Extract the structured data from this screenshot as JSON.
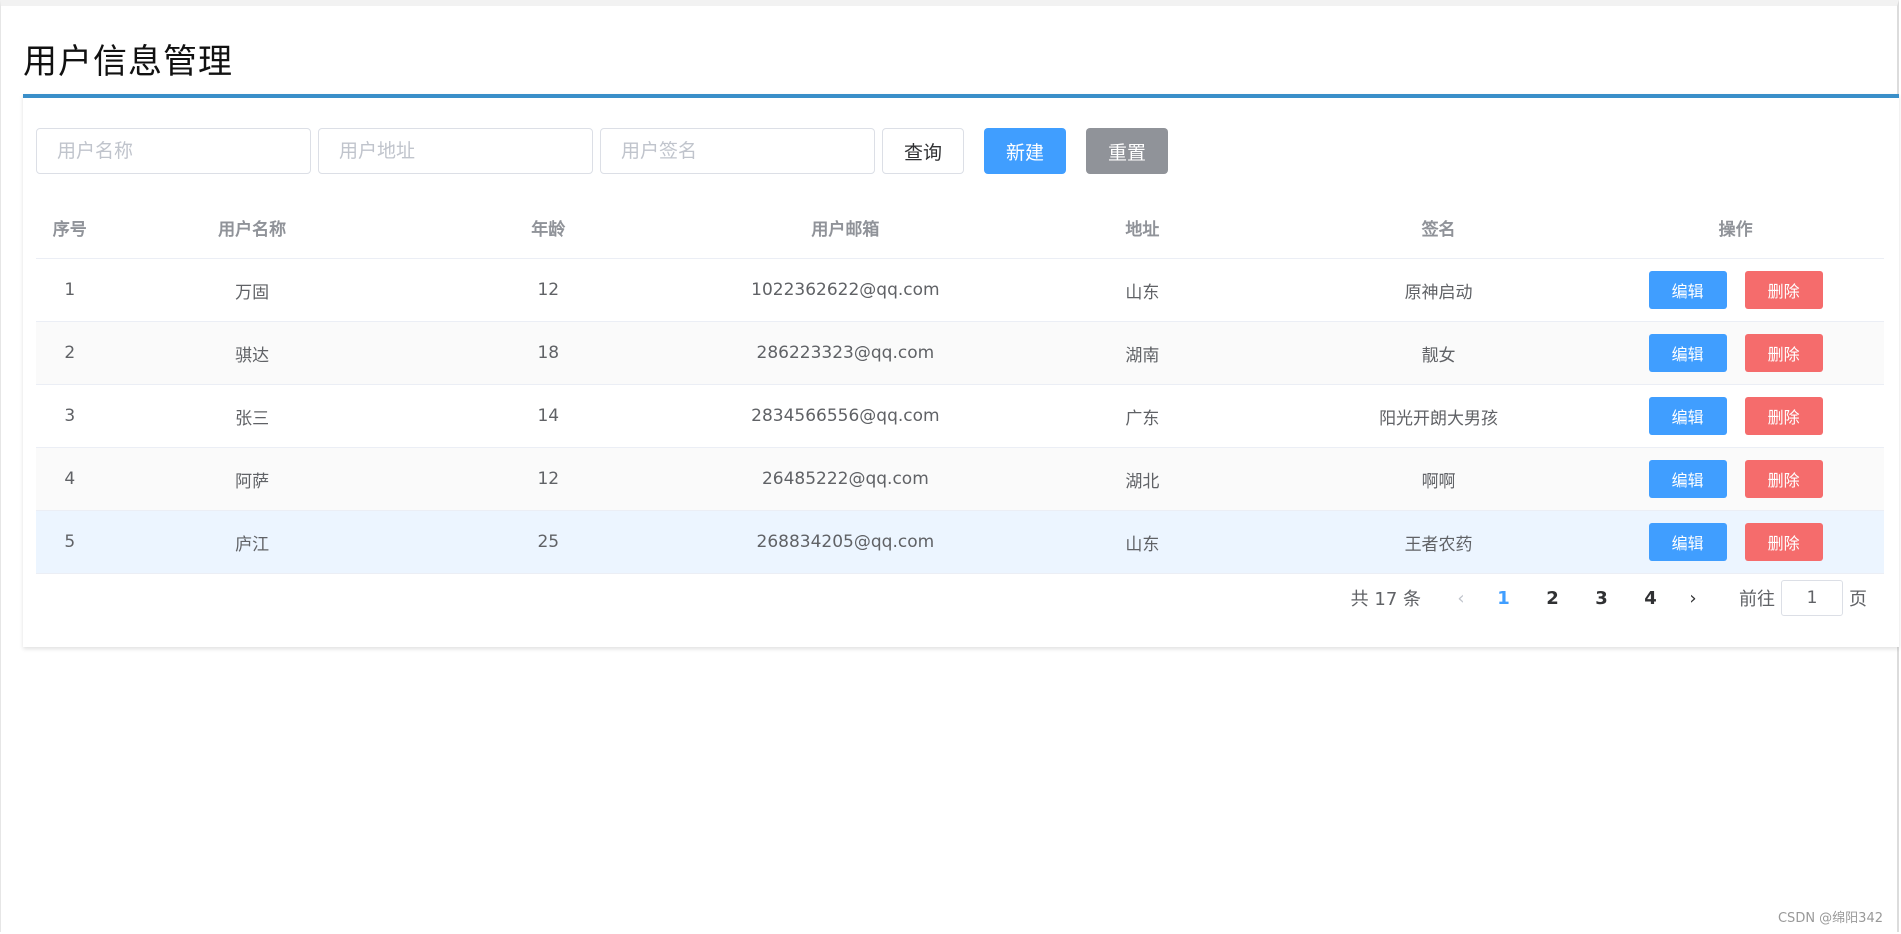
{
  "header": {
    "title": "用户信息管理"
  },
  "search": {
    "name_placeholder": "用户名称",
    "address_placeholder": "用户地址",
    "signature_placeholder": "用户签名",
    "query_label": "查询",
    "new_label": "新建",
    "reset_label": "重置"
  },
  "colors": {
    "primary": "#409eff",
    "danger": "#f56c6c",
    "info": "#909399",
    "card_accent": "#3a8fc9"
  },
  "table": {
    "headers": {
      "idx": "序号",
      "name": "用户名称",
      "age": "年龄",
      "email": "用户邮箱",
      "address": "地址",
      "signature": "签名",
      "ops": "操作"
    },
    "edit_label": "编辑",
    "delete_label": "删除",
    "rows": [
      {
        "idx": "1",
        "name": "万固",
        "age": "12",
        "email": "1022362622@qq.com",
        "address": "山东",
        "signature": "原神启动"
      },
      {
        "idx": "2",
        "name": "骐达",
        "age": "18",
        "email": "286223323@qq.com",
        "address": "湖南",
        "signature": "靓女"
      },
      {
        "idx": "3",
        "name": "张三",
        "age": "14",
        "email": "2834566556@qq.com",
        "address": "广东",
        "signature": "阳光开朗大男孩"
      },
      {
        "idx": "4",
        "name": "阿萨",
        "age": "12",
        "email": "26485222@qq.com",
        "address": "湖北",
        "signature": "啊啊"
      },
      {
        "idx": "5",
        "name": "庐江",
        "age": "25",
        "email": "268834205@qq.com",
        "address": "山东",
        "signature": "王者农药"
      }
    ]
  },
  "pagination": {
    "total": "共 17 条",
    "prev_icon": "‹",
    "next_icon": "›",
    "pages": [
      "1",
      "2",
      "3",
      "4"
    ],
    "current": "1",
    "goto_label": "前往",
    "goto_value": "1",
    "page_unit": "页"
  },
  "watermark": "CSDN @绵阳342"
}
